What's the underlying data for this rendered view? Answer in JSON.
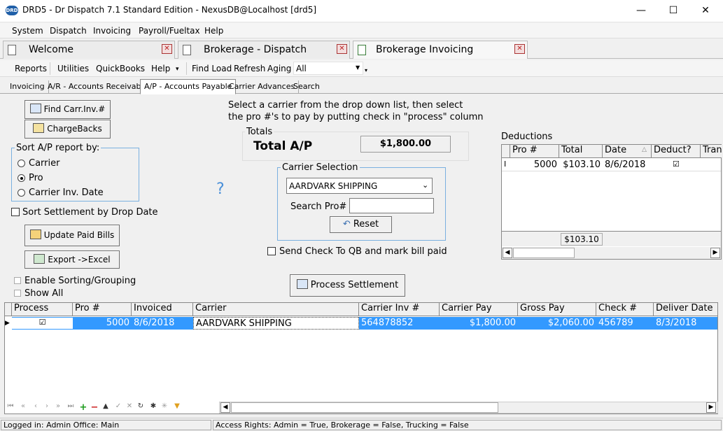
{
  "window": {
    "title": "DRD5 - Dr Dispatch 7.1 Standard Edition - NexusDB@Localhost [drd5]",
    "app_icon": "DRD",
    "min": "—",
    "max": "☐",
    "close": "✕"
  },
  "menu": [
    "System",
    "Dispatch",
    "Invoicing",
    "Payroll/Fueltax",
    "Help"
  ],
  "doc_tabs": [
    "Welcome",
    "Brokerage - Dispatch",
    "Brokerage Invoicing"
  ],
  "toolbar": {
    "items": [
      "Reports",
      "Utilities",
      "QuickBooks",
      "Help",
      "Find Load",
      "Refresh",
      "Aging"
    ],
    "aging_value": "All"
  },
  "sub_tabs": [
    "Invoicing",
    "A/R - Accounts Receivable",
    "A/P - Accounts Payable",
    "Carrier Advances",
    "Search"
  ],
  "buttons": {
    "find": "Find Carr.Inv.#",
    "chargebacks": "ChargeBacks",
    "update": "Update Paid Bills",
    "export": "Export ->Excel",
    "reset": "Reset",
    "process": "Process Settlement"
  },
  "sort_group": {
    "label": "Sort A/P report by:",
    "options": [
      "Carrier",
      "Pro",
      "Carrier Inv. Date"
    ],
    "selected": 1
  },
  "sort_settlement": "Sort Settlement by Drop Date",
  "enable_sorting": "Enable Sorting/Grouping",
  "show_all": "Show All",
  "help_mark": "?",
  "instructions": {
    "line1": "Select a carrier from the drop down list, then select",
    "line2": "the pro #'s to pay by putting check in \"process\" column"
  },
  "totals": {
    "label": "Totals",
    "title": "Total A/P",
    "value": "$1,800.00"
  },
  "carrier_selection": {
    "label": "Carrier Selection",
    "carrier": "AARDVARK SHIPPING",
    "search_label": "Search Pro#",
    "search_value": ""
  },
  "send_check": "Send Check To QB and mark bill paid",
  "deductions": {
    "label": "Deductions",
    "headers": [
      "Pro #",
      "Total",
      "Date",
      "Deduct?",
      "Tran"
    ],
    "rows": [
      {
        "pro": "5000",
        "total": "$103.10",
        "date": "8/6/2018",
        "deduct": true
      }
    ],
    "footer_total": "$103.10"
  },
  "main_grid": {
    "headers": [
      "Process",
      "Pro #",
      "Invoiced",
      "Carrier",
      "Carrier Inv #",
      "Carrier Pay",
      "Gross Pay",
      "Check #",
      "Deliver Date"
    ],
    "rows": [
      {
        "process": true,
        "pro": "5000",
        "invoiced": "8/6/2018",
        "carrier": "AARDVARK SHIPPING",
        "carrier_inv": "564878852",
        "carrier_pay": "$1,800.00",
        "gross_pay": "$2,060.00",
        "check": "456789",
        "deliver_date": "8/3/2018"
      }
    ],
    "accent": "#3399ff"
  },
  "status": {
    "left": "Logged in: Admin Office: Main",
    "right": "Access Rights: Admin = True, Brokerage = False, Trucking = False"
  }
}
